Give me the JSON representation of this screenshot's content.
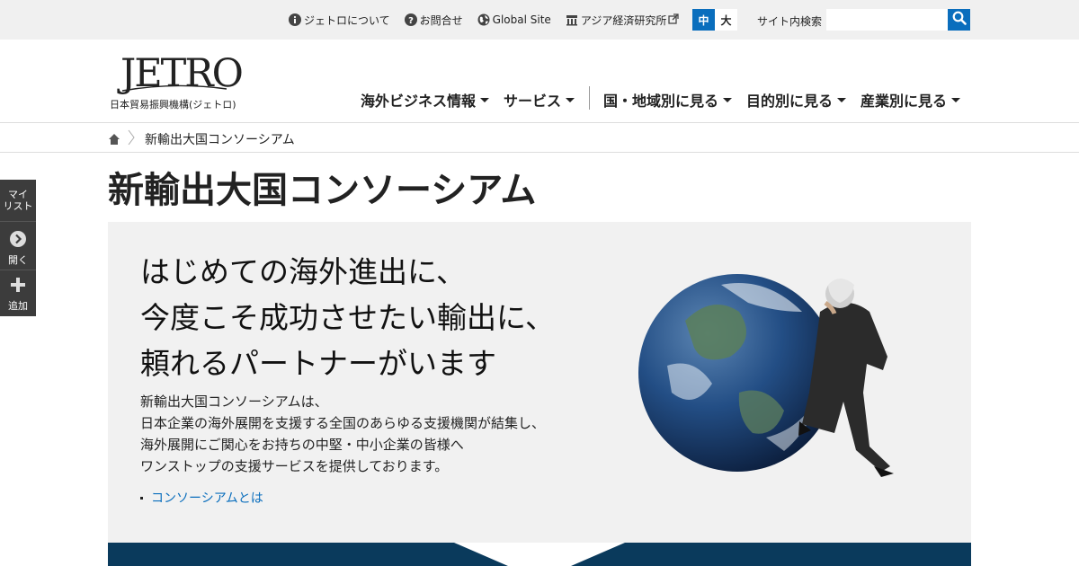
{
  "utility": {
    "links": [
      {
        "label": "ジェトロについて",
        "icon": "info-icon"
      },
      {
        "label": "お問合せ",
        "icon": "question-icon"
      },
      {
        "label": "Global Site",
        "icon": "globe-icon"
      },
      {
        "label": "アジア経済研究所",
        "icon": "building-icon",
        "trailing_icon": "external-link-icon"
      }
    ],
    "font_size": {
      "small": "中",
      "large": "大",
      "selected": "中"
    },
    "search": {
      "label": "サイト内検索",
      "placeholder": "",
      "value": ""
    }
  },
  "header": {
    "logo_text": "JETRO",
    "logo_subtitle": "日本貿易振興機構(ジェトロ)",
    "nav": [
      {
        "label": "海外ビジネス情報"
      },
      {
        "label": "サービス"
      },
      {
        "label": "国・地域別に見る"
      },
      {
        "label": "目的別に見る"
      },
      {
        "label": "産業別に見る"
      }
    ]
  },
  "breadcrumb": {
    "current": "新輸出大国コンソーシアム"
  },
  "mylist": {
    "title_line1": "マイ",
    "title_line2": "リスト",
    "open_label": "開く",
    "add_label": "追加"
  },
  "page": {
    "title": "新輸出大国コンソーシアム",
    "hero": {
      "catch": [
        "はじめての海外進出に、",
        "今度こそ成功させたい輸出に、",
        "頼れるパートナーがいます"
      ],
      "description": [
        "新輸出大国コンソーシアムは、",
        "日本企業の海外展開を支援する全国のあらゆる支援機関が結集し、",
        "海外展開にご関心をお持ちの中堅・中小企業の皆様へ",
        "ワンストップの支援サービスを提供しております。"
      ],
      "link": "コンソーシアムとは"
    }
  },
  "colors": {
    "accent": "#0a6ebd",
    "band": "#0a3a5c",
    "hero_bg": "#f1f1f1",
    "side_bg": "#3c3c3c"
  }
}
